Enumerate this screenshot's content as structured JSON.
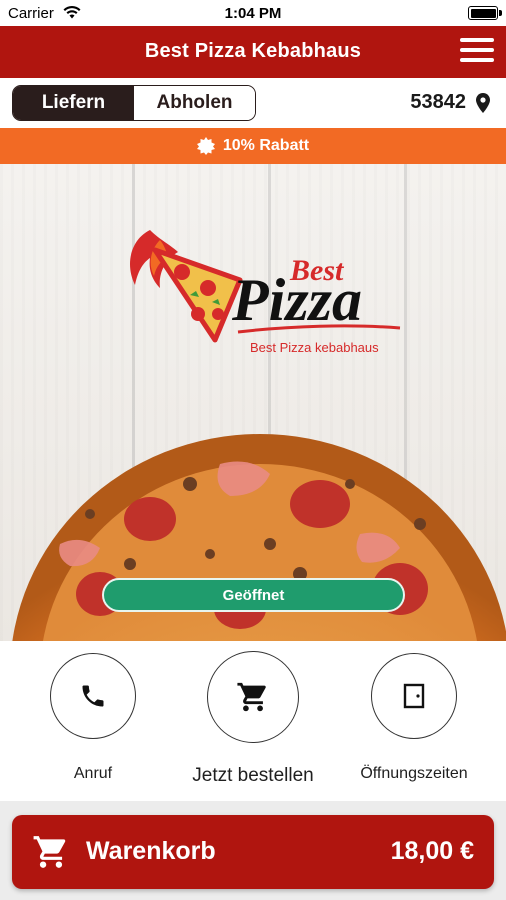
{
  "status_bar": {
    "carrier": "Carrier",
    "time": "1:04 PM"
  },
  "header": {
    "title": "Best Pizza Kebabhaus",
    "menu_icon": "hamburger-menu-icon"
  },
  "order_mode": {
    "options": [
      {
        "label": "Liefern",
        "active": true
      },
      {
        "label": "Abholen",
        "active": false
      }
    ],
    "zip": "53842",
    "zip_icon": "map-pin-icon"
  },
  "promo": {
    "text": "10% Rabatt",
    "icon": "badge-icon"
  },
  "logo": {
    "brand_word_1": "Best",
    "brand_word_2": "Pizza",
    "tagline": "Best Pizza kebabhaus"
  },
  "hero": {
    "status_label": "Geöffnet"
  },
  "actions": [
    {
      "label": "Anruf",
      "icon": "phone-icon"
    },
    {
      "label": "Jetzt bestellen",
      "icon": "shopping-cart-icon"
    },
    {
      "label": "Öffnungszeiten",
      "icon": "door-icon"
    }
  ],
  "cart": {
    "label": "Warenkorb",
    "total": "18,00 €",
    "icon": "shopping-cart-icon"
  },
  "colors": {
    "brand_red": "#b0150f",
    "promo_orange": "#f26a24",
    "open_green": "#1f9c6d",
    "segment_dark": "#2a1d1c"
  }
}
